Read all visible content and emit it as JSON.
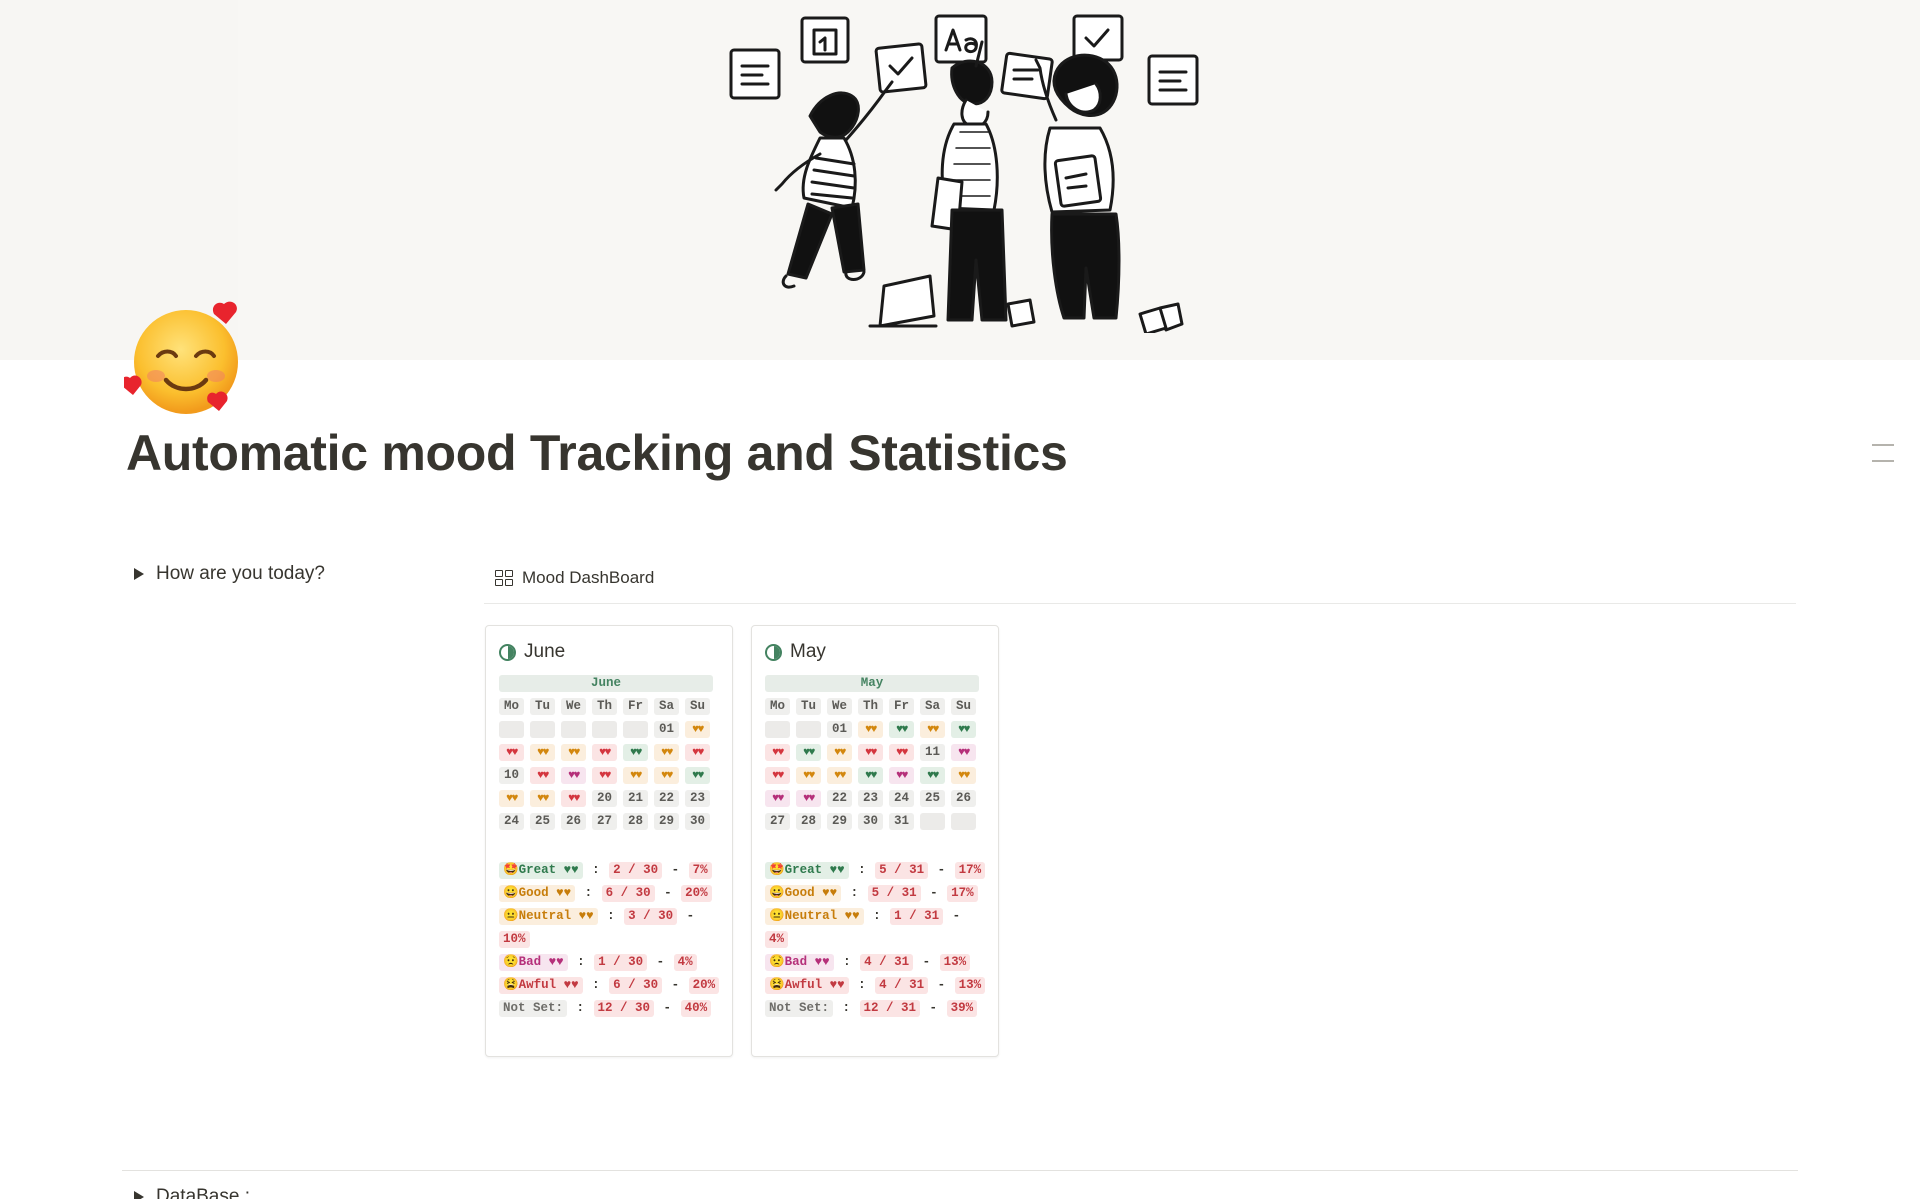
{
  "page": {
    "title": "Automatic mood Tracking and Statistics",
    "emoji": "smiling-face-with-hearts"
  },
  "toggles": {
    "mood_question": "How are you today?",
    "database": "DataBase :"
  },
  "dashboard": {
    "view_label": "Mood DashBoard",
    "cards": [
      {
        "name": "June",
        "calendar_title": "June",
        "weekdays": [
          "Mo",
          "Tu",
          "We",
          "Th",
          "Fr",
          "Sa",
          "Su"
        ],
        "weeks": [
          [
            {
              "t": "",
              "m": "empty"
            },
            {
              "t": "",
              "m": "empty"
            },
            {
              "t": "",
              "m": "empty"
            },
            {
              "t": "",
              "m": "empty"
            },
            {
              "t": "",
              "m": "empty"
            },
            {
              "t": "01",
              "m": "num"
            },
            {
              "t": "♥♥",
              "m": "neutral"
            }
          ],
          [
            {
              "t": "♥♥",
              "m": "awful"
            },
            {
              "t": "♥♥",
              "m": "good"
            },
            {
              "t": "♥♥",
              "m": "good"
            },
            {
              "t": "♥♥",
              "m": "awful"
            },
            {
              "t": "♥♥",
              "m": "great"
            },
            {
              "t": "♥♥",
              "m": "good"
            },
            {
              "t": "♥♥",
              "m": "awful"
            }
          ],
          [
            {
              "t": "10",
              "m": "num"
            },
            {
              "t": "♥♥",
              "m": "awful"
            },
            {
              "t": "♥♥",
              "m": "bad"
            },
            {
              "t": "♥♥",
              "m": "awful"
            },
            {
              "t": "♥♥",
              "m": "neutral"
            },
            {
              "t": "♥♥",
              "m": "good"
            },
            {
              "t": "♥♥",
              "m": "great"
            }
          ],
          [
            {
              "t": "♥♥",
              "m": "neutral"
            },
            {
              "t": "♥♥",
              "m": "neutral"
            },
            {
              "t": "♥♥",
              "m": "awful"
            },
            {
              "t": "20",
              "m": "num"
            },
            {
              "t": "21",
              "m": "num"
            },
            {
              "t": "22",
              "m": "num"
            },
            {
              "t": "23",
              "m": "num"
            }
          ],
          [
            {
              "t": "24",
              "m": "num"
            },
            {
              "t": "25",
              "m": "num"
            },
            {
              "t": "26",
              "m": "num"
            },
            {
              "t": "27",
              "m": "num"
            },
            {
              "t": "28",
              "m": "num"
            },
            {
              "t": "29",
              "m": "num"
            },
            {
              "t": "30",
              "m": "num"
            }
          ]
        ],
        "stats": [
          {
            "label": "🤩Great ♥♥",
            "cls": "great",
            "count": "2 / 30",
            "pct": "7%"
          },
          {
            "label": "😀Good ♥♥",
            "cls": "good",
            "count": "6 / 30",
            "pct": "20%"
          },
          {
            "label": "😐Neutral ♥♥",
            "cls": "neutral",
            "count": "3 / 30",
            "pct": "10%"
          },
          {
            "label": "😟Bad ♥♥",
            "cls": "bad",
            "count": "1 / 30",
            "pct": "4%"
          },
          {
            "label": "😫Awful ♥♥",
            "cls": "awful",
            "count": "6 / 30",
            "pct": "20%"
          },
          {
            "label": "Not Set:",
            "cls": "notset",
            "count": "12 / 30",
            "pct": "40%"
          }
        ]
      },
      {
        "name": "May",
        "calendar_title": "May",
        "weekdays": [
          "Mo",
          "Tu",
          "We",
          "Th",
          "Fr",
          "Sa",
          "Su"
        ],
        "weeks": [
          [
            {
              "t": "",
              "m": "empty"
            },
            {
              "t": "",
              "m": "empty"
            },
            {
              "t": "01",
              "m": "num"
            },
            {
              "t": "♥♥",
              "m": "neutral"
            },
            {
              "t": "♥♥",
              "m": "great"
            },
            {
              "t": "♥♥",
              "m": "good"
            },
            {
              "t": "♥♥",
              "m": "great"
            }
          ],
          [
            {
              "t": "♥♥",
              "m": "awful"
            },
            {
              "t": "♥♥",
              "m": "great"
            },
            {
              "t": "♥♥",
              "m": "good"
            },
            {
              "t": "♥♥",
              "m": "awful"
            },
            {
              "t": "♥♥",
              "m": "awful"
            },
            {
              "t": "11",
              "m": "num"
            },
            {
              "t": "♥♥",
              "m": "bad"
            }
          ],
          [
            {
              "t": "♥♥",
              "m": "awful"
            },
            {
              "t": "♥♥",
              "m": "good"
            },
            {
              "t": "♥♥",
              "m": "good"
            },
            {
              "t": "♥♥",
              "m": "great"
            },
            {
              "t": "♥♥",
              "m": "bad"
            },
            {
              "t": "♥♥",
              "m": "great"
            },
            {
              "t": "♥♥",
              "m": "neutral"
            }
          ],
          [
            {
              "t": "♥♥",
              "m": "bad"
            },
            {
              "t": "♥♥",
              "m": "bad"
            },
            {
              "t": "22",
              "m": "num"
            },
            {
              "t": "23",
              "m": "num"
            },
            {
              "t": "24",
              "m": "num"
            },
            {
              "t": "25",
              "m": "num"
            },
            {
              "t": "26",
              "m": "num"
            }
          ],
          [
            {
              "t": "27",
              "m": "num"
            },
            {
              "t": "28",
              "m": "num"
            },
            {
              "t": "29",
              "m": "num"
            },
            {
              "t": "30",
              "m": "num"
            },
            {
              "t": "31",
              "m": "num"
            },
            {
              "t": "",
              "m": "empty"
            },
            {
              "t": "",
              "m": "empty"
            }
          ]
        ],
        "stats": [
          {
            "label": "🤩Great ♥♥",
            "cls": "great",
            "count": "5 / 31",
            "pct": "17%"
          },
          {
            "label": "😀Good ♥♥",
            "cls": "good",
            "count": "5 / 31",
            "pct": "17%"
          },
          {
            "label": "😐Neutral ♥♥",
            "cls": "neutral",
            "count": "1 / 31",
            "pct": "4%"
          },
          {
            "label": "😟Bad ♥♥",
            "cls": "bad",
            "count": "4 / 31",
            "pct": "13%"
          },
          {
            "label": "😫Awful ♥♥",
            "cls": "awful",
            "count": "4 / 31",
            "pct": "13%"
          },
          {
            "label": "Not Set:",
            "cls": "notset",
            "count": "12 / 31",
            "pct": "39%"
          }
        ]
      }
    ]
  },
  "colors": {
    "great": "#2f7a4d",
    "good": "#d3870e",
    "bad": "#b5307a",
    "awful": "#d4363f",
    "cover_bg": "#f7f6f3"
  }
}
